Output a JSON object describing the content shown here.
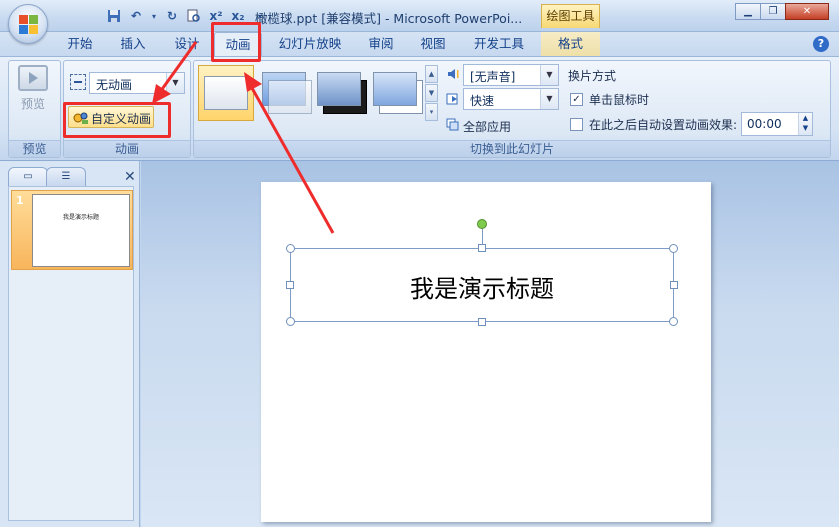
{
  "titlebar": {
    "title": "橄榄球.ppt [兼容模式] - Microsoft PowerPoi...",
    "context_tab": "绘图工具"
  },
  "tabs": [
    {
      "label": "开始"
    },
    {
      "label": "插入"
    },
    {
      "label": "设计"
    },
    {
      "label": "动画"
    },
    {
      "label": "幻灯片放映"
    },
    {
      "label": "审阅"
    },
    {
      "label": "视图"
    },
    {
      "label": "开发工具"
    },
    {
      "label": "格式"
    }
  ],
  "ribbon": {
    "preview": {
      "button_label": "预览",
      "group_label": "预览"
    },
    "animation": {
      "dropdown_value": "无动画",
      "custom_button": "自定义动画",
      "group_label": "动画"
    },
    "transition": {
      "sound_value": "[无声音]",
      "speed_value": "快速",
      "apply_all": "全部应用",
      "advance_title": "换片方式",
      "on_click_label": "单击鼠标时",
      "on_click_checked": true,
      "auto_label": "在此之后自动设置动画效果:",
      "auto_checked": false,
      "auto_time": "00:00",
      "group_label": "切换到此幻灯片"
    }
  },
  "slides_pane": {
    "slide_number": "1",
    "thumb_title": "我是演示标题"
  },
  "slide": {
    "title": "我是演示标题"
  },
  "colors": {
    "annotation_red": "#ee2c2c",
    "selection_orange": "#f8b55c",
    "ribbon_text": "#15428b"
  }
}
